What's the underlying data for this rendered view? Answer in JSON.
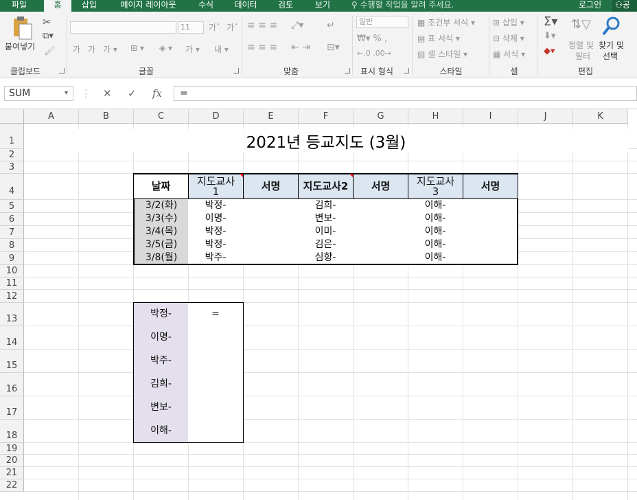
{
  "ribbon_tabs": [
    "파일",
    "홈",
    "삽입",
    "페이지 레이아웃",
    "수식",
    "데이터",
    "검토",
    "보기"
  ],
  "active_tab": "홈",
  "tell_me": "수행할 작업을 알려 주세요.",
  "login": "로그인",
  "share": "공",
  "clipboard": {
    "paste": "붙여넣기",
    "group": "클립보드"
  },
  "font": {
    "name": "",
    "size": "11",
    "group": "글꼴"
  },
  "alignment": {
    "group": "맞춤"
  },
  "number": {
    "format": "일반",
    "group": "표시 형식"
  },
  "styles": {
    "conditional": "조건부 서식",
    "table": "표 서식",
    "cell": "셀 스타일",
    "group": "스타일"
  },
  "cells": {
    "insert": "삽입",
    "delete": "삭제",
    "format": "서식",
    "group": "셀"
  },
  "editing": {
    "sort_line1": "정렬 및",
    "sort_line2": "필터",
    "find_line1": "찾기 및",
    "find_line2": "선택",
    "group": "편집"
  },
  "formula_bar": {
    "name_box": "SUM",
    "formula": "="
  },
  "columns": [
    "A",
    "B",
    "C",
    "D",
    "E",
    "F",
    "G",
    "H",
    "I",
    "J",
    "K"
  ],
  "rows": [
    "1",
    "2",
    "3",
    "4",
    "5",
    "6",
    "7",
    "8",
    "9",
    "10",
    "11",
    "12",
    "13",
    "14",
    "15",
    "16",
    "17",
    "18",
    "19",
    "20",
    "21",
    "22"
  ],
  "sheet": {
    "title": "2021년 등교지도 (3월)",
    "headers": [
      "날짜",
      "지도교사\n1",
      "서명",
      "지도교사2",
      "서명",
      "지도교사\n3",
      "서명"
    ],
    "header_teacher1_line1": "지도교사",
    "header_teacher1_line2": "1",
    "header_teacher3_line1": "지도교사",
    "header_teacher3_line2": "3",
    "rows": [
      {
        "date": "3/2(화)",
        "t1": "박정-",
        "t2": "김희-",
        "t3": "이해-"
      },
      {
        "date": "3/3(수)",
        "t1": "이명-",
        "t2": "변보-",
        "t3": "이해-"
      },
      {
        "date": "3/4(목)",
        "t1": "박정-",
        "t2": "이미-",
        "t3": "이해-"
      },
      {
        "date": "3/5(금)",
        "t1": "박정-",
        "t2": "김은-",
        "t3": "이해-"
      },
      {
        "date": "3/8(월)",
        "t1": "박주-",
        "t2": "심향-",
        "t3": "이해-"
      }
    ],
    "summary": [
      {
        "name": "박정-",
        "value": "="
      },
      {
        "name": "이명-",
        "value": ""
      },
      {
        "name": "박주-",
        "value": ""
      },
      {
        "name": "김희-",
        "value": ""
      },
      {
        "name": "변보-",
        "value": ""
      },
      {
        "name": "이해-",
        "value": ""
      }
    ]
  },
  "colors": {
    "excel_green": "#217346",
    "header_fill": "#dce6f1",
    "date_fill": "#d9d9d9",
    "summary_fill": "#e4dfec"
  }
}
